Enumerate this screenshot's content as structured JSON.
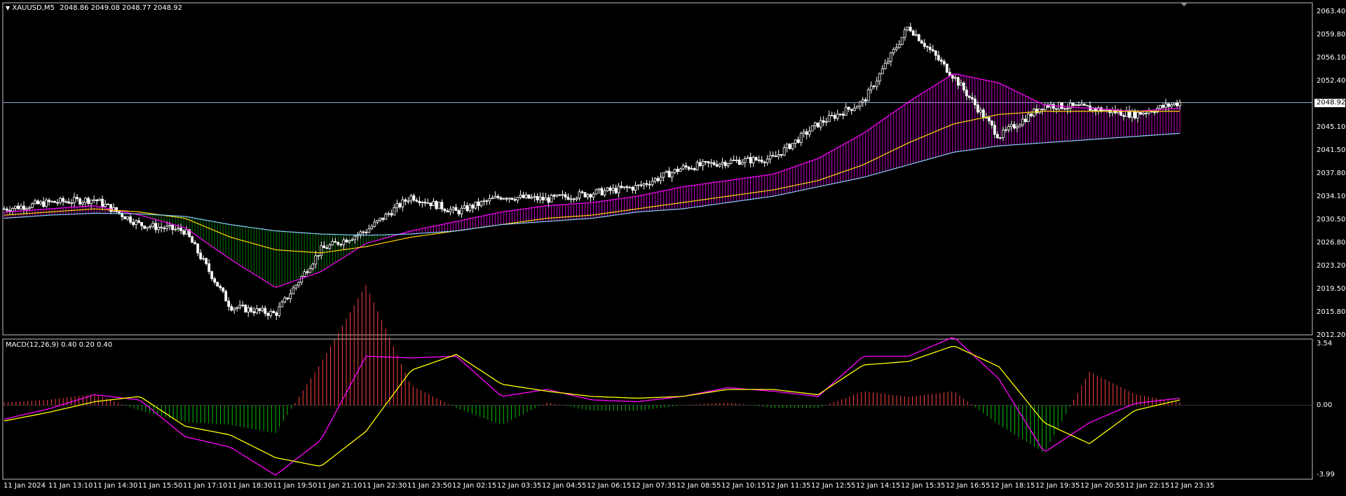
{
  "app": {
    "symbol": "XAUUSD,M5",
    "ohlc": "2048.86 2049.08 2048.77 2048.92",
    "current_price": "2048.92"
  },
  "price_axis": {
    "ticks": [
      "2063.40",
      "2059.80",
      "2056.10",
      "2052.40",
      "2048.75",
      "2045.10",
      "2041.50",
      "2037.80",
      "2034.10",
      "2030.50",
      "2026.80",
      "2023.20",
      "2019.50",
      "2015.80",
      "2012.20"
    ]
  },
  "macd": {
    "title": "MACD(12,26,9) 0.40 0.20 0.40",
    "ticks": [
      "3.54",
      "0.00",
      "-3.99"
    ]
  },
  "time_axis": {
    "ticks": [
      "11 Jan 2024",
      "11 Jan 13:10",
      "11 Jan 14:30",
      "11 Jan 15:50",
      "11 Jan 17:10",
      "11 Jan 18:30",
      "11 Jan 19:50",
      "11 Jan 21:10",
      "11 Jan 22:30",
      "11 Jan 23:50",
      "12 Jan 02:15",
      "12 Jan 03:35",
      "12 Jan 04:55",
      "12 Jan 06:15",
      "12 Jan 07:35",
      "12 Jan 08:55",
      "12 Jan 10:15",
      "12 Jan 11:35",
      "12 Jan 12:55",
      "12 Jan 14:15",
      "12 Jan 15:35",
      "12 Jan 16:55",
      "12 Jan 18:15",
      "12 Jan 19:35",
      "12 Jan 20:55",
      "12 Jan 22:15",
      "12 Jan 23:35"
    ]
  },
  "colors": {
    "background": "#000000",
    "grid_border": "#c0c0c0",
    "candle": "#ffffff",
    "ribbon_up": "#ff00ff",
    "ribbon_down": "#00a000",
    "ma_fast": "#ff00ff",
    "ma_mid": "#ffd700",
    "ma_slow": "#87cefa",
    "hist_up": "#ff4040",
    "hist_down": "#00c000",
    "macd_line": "#ff00ff",
    "signal_line": "#ffff00"
  },
  "chart_data": {
    "type": "line",
    "title": "XAUUSD,M5",
    "x_labels": [
      "11 Jan 2024",
      "11 Jan 13:10",
      "11 Jan 14:30",
      "11 Jan 15:50",
      "11 Jan 17:10",
      "11 Jan 18:30",
      "11 Jan 19:50",
      "11 Jan 21:10",
      "11 Jan 22:30",
      "11 Jan 23:50",
      "12 Jan 02:15",
      "12 Jan 03:35",
      "12 Jan 04:55",
      "12 Jan 06:15",
      "12 Jan 07:35",
      "12 Jan 08:55",
      "12 Jan 10:15",
      "12 Jan 11:35",
      "12 Jan 12:55",
      "12 Jan 14:15",
      "12 Jan 15:35",
      "12 Jan 16:55",
      "12 Jan 18:15",
      "12 Jan 19:35",
      "12 Jan 20:55",
      "12 Jan 22:15",
      "12 Jan 23:35"
    ],
    "ylim": [
      2012.2,
      2063.4
    ],
    "series": [
      {
        "values": [
          2032.0,
          2033.0,
          2033.5,
          2029.5,
          2028.5,
          2016.5,
          2015.3,
          2025.5,
          2028.5,
          2034.0,
          2031.5,
          2034.0,
          2033.5,
          2034.5,
          2035.5,
          2038.5,
          2039.5,
          2040.0,
          2045.5,
          2049.0,
          2061.0,
          2053.0,
          2043.5,
          2048.5,
          2048.0,
          2047.0,
          2048.9
        ]
      },
      {
        "values": [
          2031.5,
          2032.0,
          2032.5,
          2031.0,
          2029.0,
          2024.0,
          2019.5,
          2022.0,
          2026.5,
          2028.5,
          2030.0,
          2031.5,
          2032.5,
          2033.0,
          2034.0,
          2035.5,
          2036.5,
          2037.5,
          2040.0,
          2044.0,
          2049.0,
          2053.5,
          2052.0,
          2048.5,
          2048.0,
          2047.5,
          2048.0
        ]
      },
      {
        "values": [
          2031.0,
          2031.5,
          2032.0,
          2031.5,
          2030.5,
          2027.5,
          2025.5,
          2025.0,
          2026.0,
          2027.5,
          2028.5,
          2029.5,
          2030.5,
          2031.0,
          2032.0,
          2033.0,
          2034.0,
          2035.0,
          2036.5,
          2039.0,
          2042.5,
          2045.5,
          2047.0,
          2047.5,
          2047.5,
          2047.5,
          2047.5
        ]
      },
      {
        "values": [
          2030.5,
          2031.0,
          2031.3,
          2031.2,
          2030.8,
          2029.5,
          2028.5,
          2028.0,
          2027.8,
          2028.0,
          2028.5,
          2029.5,
          2030.0,
          2030.5,
          2031.5,
          2032.0,
          2033.0,
          2034.0,
          2035.5,
          2037.0,
          2039.0,
          2041.0,
          2042.0,
          2042.5,
          2043.0,
          2043.5,
          2044.0
        ]
      }
    ]
  },
  "macd_data": {
    "ylim": [
      -3.99,
      3.54
    ],
    "macd": [
      -0.8,
      -0.2,
      0.6,
      0.3,
      -1.8,
      -2.4,
      -4.0,
      -2.0,
      2.8,
      2.7,
      2.8,
      0.5,
      0.9,
      0.3,
      0.2,
      0.5,
      1.0,
      0.8,
      0.5,
      2.8,
      2.8,
      3.9,
      1.5,
      -2.7,
      -1.0,
      0.1,
      0.4
    ],
    "signal": [
      -0.9,
      -0.4,
      0.2,
      0.5,
      -1.2,
      -1.7,
      -3.0,
      -3.5,
      -1.5,
      2.0,
      2.9,
      1.2,
      0.8,
      0.5,
      0.4,
      0.5,
      0.9,
      0.9,
      0.6,
      2.3,
      2.5,
      3.4,
      2.2,
      -1.0,
      -2.2,
      -0.3,
      0.3
    ]
  }
}
